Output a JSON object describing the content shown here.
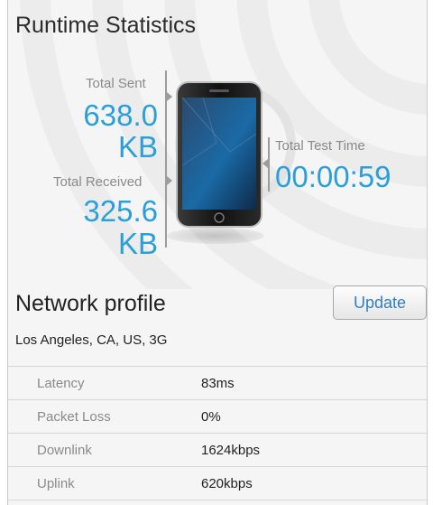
{
  "header": {
    "title": "Runtime Statistics"
  },
  "stats": {
    "sent_label": "Total Sent",
    "sent_value_line1": "638.0",
    "sent_value_line2": "KB",
    "received_label": "Total Received",
    "received_value_line1": "325.6",
    "received_value_line2": "KB",
    "time_label": "Total Test Time",
    "time_value": "00:00:59"
  },
  "network": {
    "title": "Network profile",
    "update_label": "Update",
    "location": "Los Angeles, CA, US, 3G",
    "rows": [
      {
        "label": "Latency",
        "value": "83ms"
      },
      {
        "label": "Packet Loss",
        "value": "0%"
      },
      {
        "label": "Downlink",
        "value": "1624kbps"
      },
      {
        "label": "Uplink",
        "value": "620kbps"
      }
    ]
  },
  "colors": {
    "accent": "#2a9fd8",
    "button_text": "#2f7fc0"
  },
  "icons": {
    "device": "smartphone-icon"
  }
}
